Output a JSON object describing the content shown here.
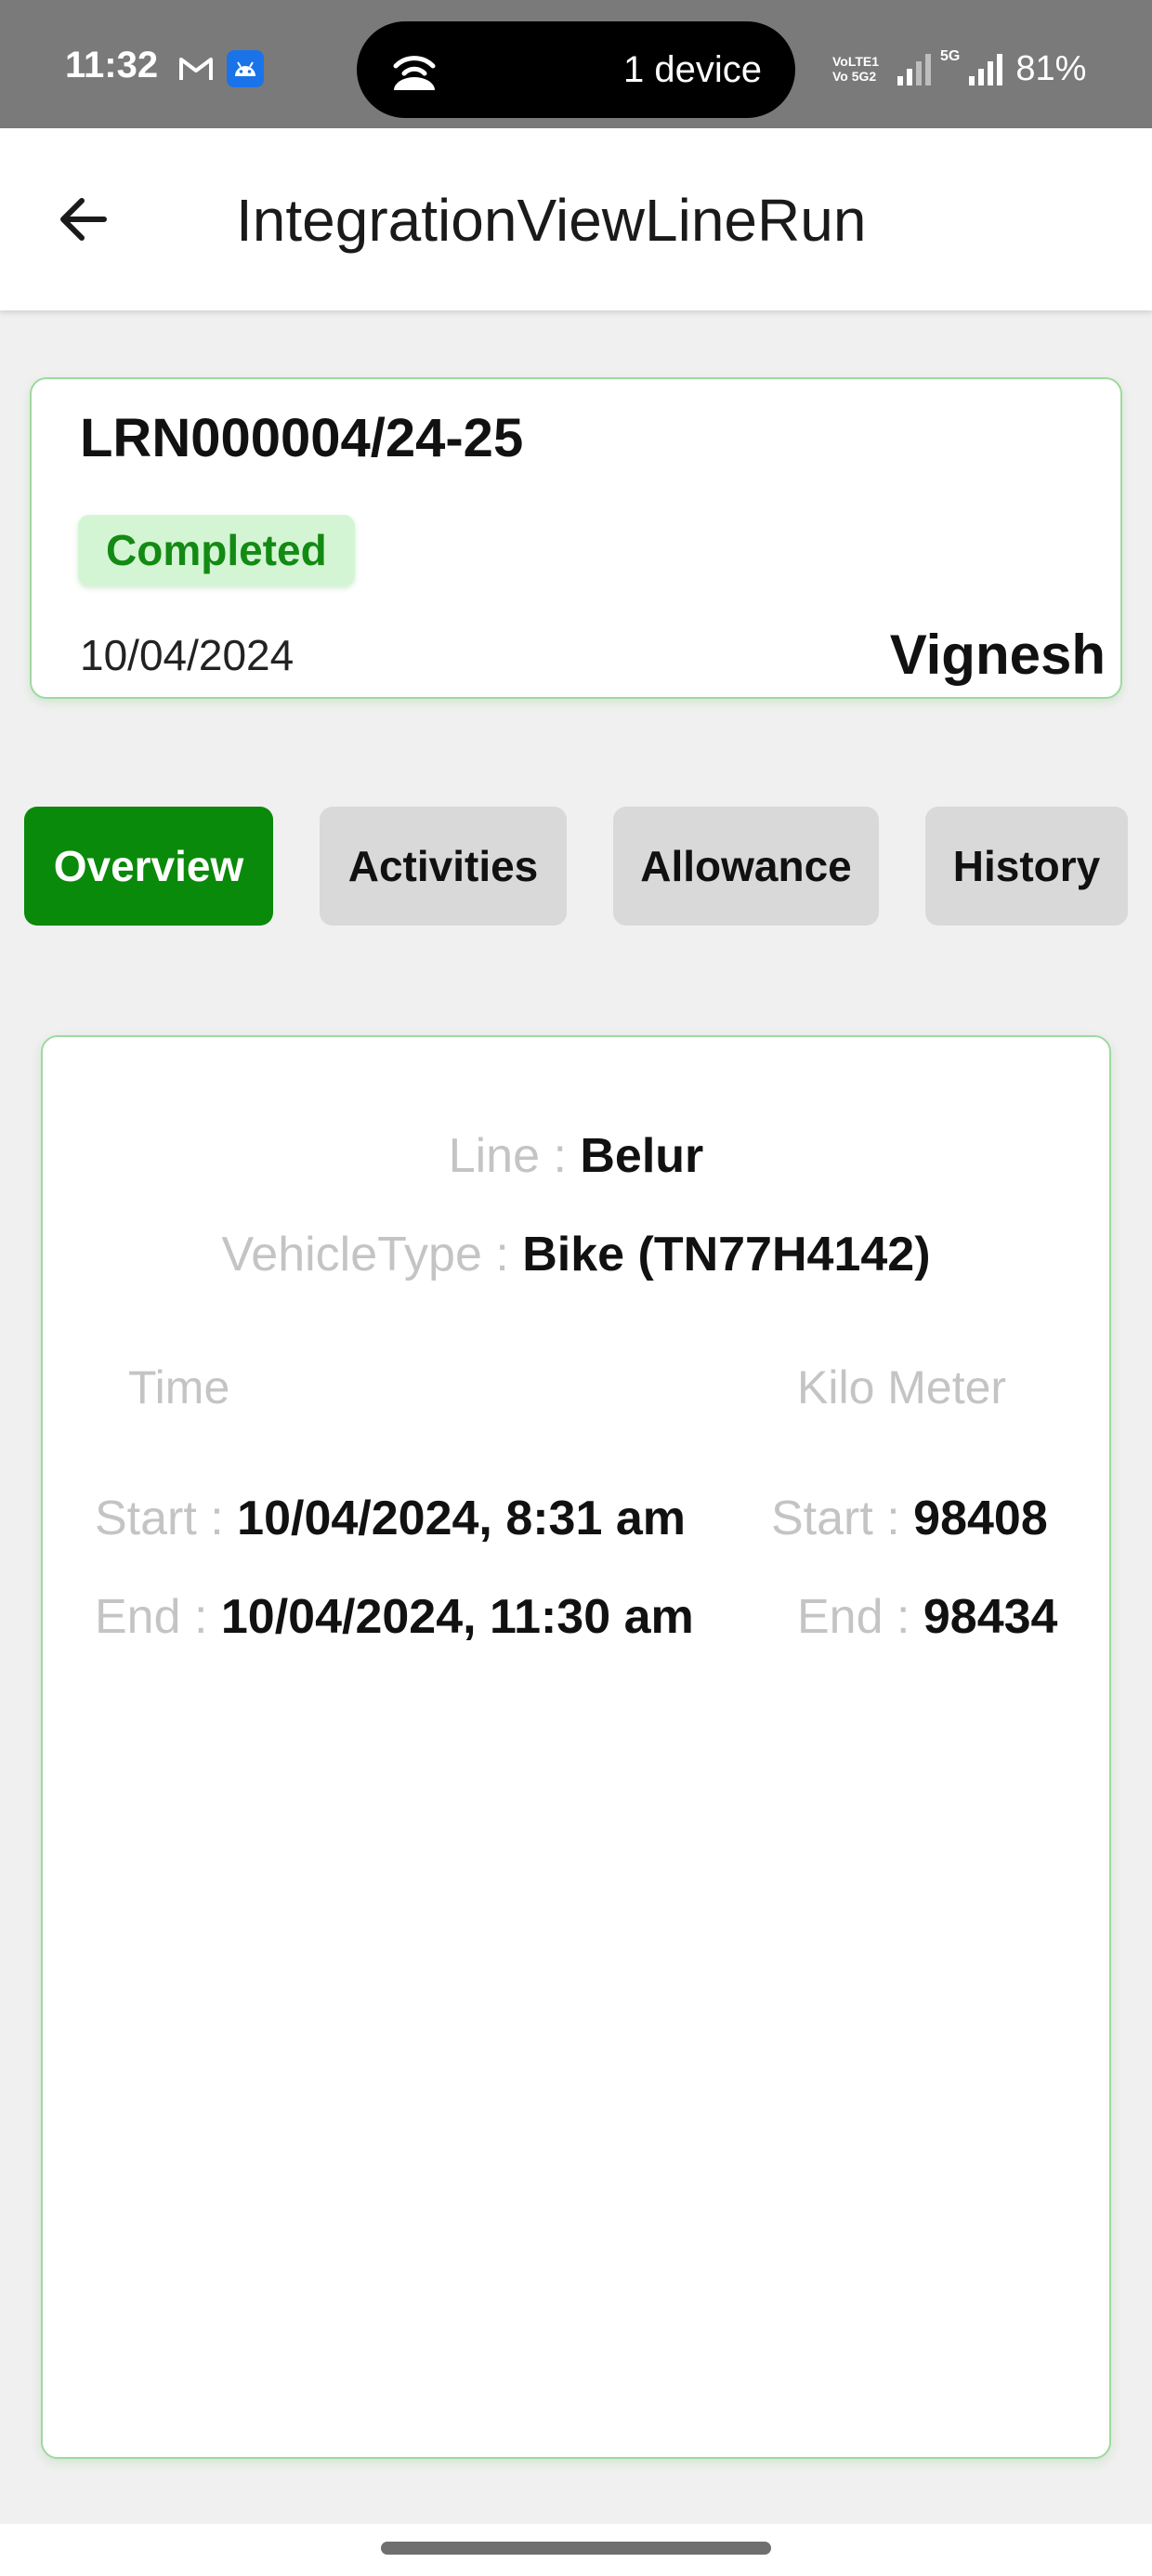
{
  "status_bar": {
    "time": "11:32",
    "hotspot_text": "1 device",
    "volte_line1": "VoLTE1",
    "volte_line2": "Vo 5G2",
    "network": "5G",
    "battery": "81%"
  },
  "app_bar": {
    "title": "IntegrationViewLineRun"
  },
  "run": {
    "number": "LRN000004/24-25",
    "status": "Completed",
    "date": "10/04/2024",
    "user": "Vignesh"
  },
  "tabs": [
    {
      "label": "Overview",
      "active": true
    },
    {
      "label": "Activities",
      "active": false
    },
    {
      "label": "Allowance",
      "active": false
    },
    {
      "label": "History",
      "active": false
    }
  ],
  "overview": {
    "line_label": "Line :",
    "line_value": "Belur",
    "vehicle_label": "VehicleType :",
    "vehicle_value": "Bike (TN77H4142)",
    "time_header": "Time",
    "km_header": "Kilo Meter",
    "time_start_label": "Start :",
    "time_start_value": "10/04/2024, 8:31 am",
    "time_end_label": "End :",
    "time_end_value": "10/04/2024, 11:30 am",
    "km_start_label": "Start :",
    "km_start_value": "98408",
    "km_end_label": "End :",
    "km_end_value": "98434"
  },
  "colors": {
    "accent_green": "#0a8a0a",
    "badge_bg": "#d4f5d4",
    "card_border": "#9fd89f",
    "label_grey": "#c4c4c4"
  }
}
